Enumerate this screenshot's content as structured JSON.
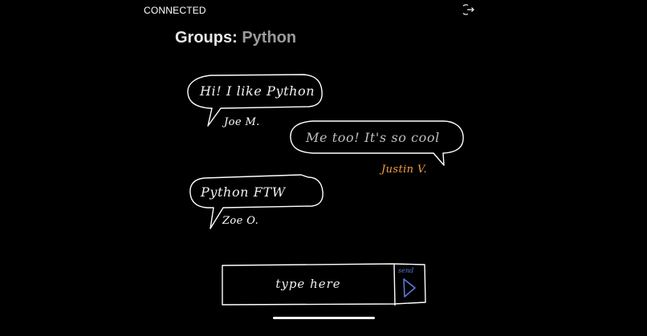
{
  "status": {
    "connection": "CONNECTED"
  },
  "header": {
    "title_label": "Groups:",
    "group_name": "Python",
    "logout_icon": "logout-icon"
  },
  "messages": [
    {
      "text": "Hi! I like Python",
      "author": "Joe M.",
      "author_color": "#ffffff"
    },
    {
      "text": "Me too! It's so cool",
      "author": "Justin V.",
      "author_color": "#f5a142"
    },
    {
      "text": "Python FTW",
      "author": "Zoe O.",
      "author_color": "#ffffff"
    }
  ],
  "composer": {
    "placeholder": "type here",
    "send_label": "send",
    "send_icon": "send-arrow-icon",
    "send_color": "#5b7bd6"
  },
  "colors": {
    "background": "#000000",
    "foreground": "#ffffff",
    "own_message_text": "#bfbfbf"
  }
}
